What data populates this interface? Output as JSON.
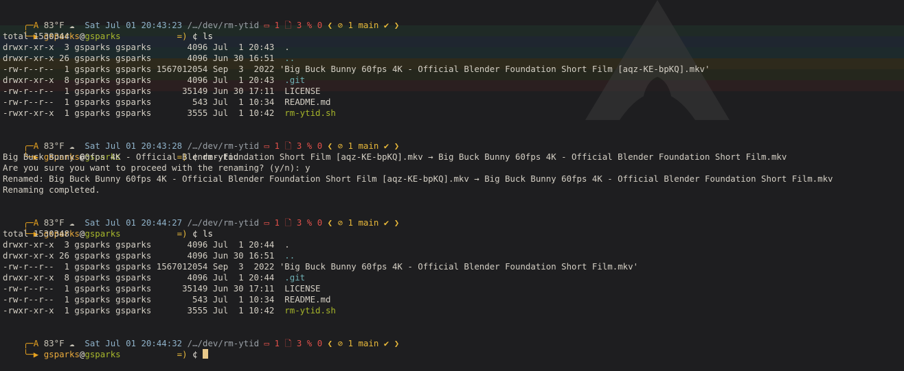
{
  "theme": {
    "accent": "#e6a11f",
    "background": "#1e1e20",
    "user_color": "#e8a93c",
    "host_color": "#a8b82c",
    "git_status_red": "#e0504a",
    "git_branch_yellow": "#e8b83a",
    "script_green": "#a6b52a",
    "dir_teal": "#6fb0b4"
  },
  "icons": {
    "prompt_corner": "╭─",
    "prompt_corner_bottom": "╰─▶",
    "weather": "☁",
    "folder": "▭",
    "file": "🗋",
    "percent": "%",
    "branch": "⊘",
    "diverge": "⫰",
    "check": "✔",
    "chevron_left": "❮",
    "chevron_right": "❯",
    "shell_symbol": "¢"
  },
  "prompts": [
    {
      "top": {
        "arrow": "A",
        "temp": "83°F",
        "datetime": "Sat Jul 01 20:43:23",
        "path": "/…/dev/rm-ytid",
        "folders": "1",
        "files": "3",
        "percent": "0",
        "ahead": "1",
        "branch": "main"
      },
      "bottom": {
        "user": "gsparks",
        "at": "@",
        "host": "gsparks",
        "pad": "           ",
        "eq": "=)",
        "sym": "¢",
        "command": "ls"
      }
    },
    {
      "top": {
        "arrow": "A",
        "temp": "83°F",
        "datetime": "Sat Jul 01 20:43:28",
        "path": "/…/dev/rm-ytid",
        "folders": "1",
        "files": "3",
        "percent": "0",
        "ahead": "1",
        "branch": "main"
      },
      "bottom": {
        "user": "gsparks",
        "at": "@",
        "host": "gsparks",
        "pad": "           ",
        "eq": "=)",
        "sym": "¢",
        "command": "rm-ytid"
      }
    },
    {
      "top": {
        "arrow": "A",
        "temp": "83°F",
        "datetime": "Sat Jul 01 20:44:27",
        "path": "/…/dev/rm-ytid",
        "folders": "1",
        "files": "3",
        "percent": "0",
        "ahead": "1",
        "branch": "main"
      },
      "bottom": {
        "user": "gsparks",
        "at": "@",
        "host": "gsparks",
        "pad": "           ",
        "eq": "=)",
        "sym": "¢",
        "command": "ls"
      }
    },
    {
      "top": {
        "arrow": "A",
        "temp": "83°F",
        "datetime": "Sat Jul 01 20:44:32",
        "path": "/…/dev/rm-ytid",
        "folders": "1",
        "files": "3",
        "percent": "0",
        "ahead": "1",
        "branch": "main"
      },
      "bottom": {
        "user": "gsparks",
        "at": "@",
        "host": "gsparks",
        "pad": "           ",
        "eq": "=)",
        "sym": "¢",
        "command": ""
      }
    }
  ],
  "ls1": {
    "total": "total 1530344",
    "rows": [
      {
        "meta": "drwxr-xr-x  3 gsparks gsparks       4096 Jul  1 20:43  ",
        "name": ".",
        "kind": "plain"
      },
      {
        "meta": "drwxr-xr-x 26 gsparks gsparks       4096 Jun 30 16:51  ",
        "name": "..",
        "kind": "dir"
      },
      {
        "meta": "-rw-r--r--  1 gsparks gsparks 1567012054 Sep  3  2022 ",
        "name": "'Big Buck Bunny 60fps 4K - Official Blender Foundation Short Film [aqz-KE-bpKQ].mkv'",
        "kind": "plain"
      },
      {
        "meta": "drwxr-xr-x  8 gsparks gsparks       4096 Jul  1 20:43  ",
        "name": ".git",
        "kind": "dir"
      },
      {
        "meta": "-rw-r--r--  1 gsparks gsparks      35149 Jun 30 17:11  ",
        "name": "LICENSE",
        "kind": "plain"
      },
      {
        "meta": "-rw-r--r--  1 gsparks gsparks        543 Jul  1 10:34  ",
        "name": "README.md",
        "kind": "plain"
      },
      {
        "meta": "-rwxr-xr-x  1 gsparks gsparks       3555 Jul  1 10:42  ",
        "name": "rm-ytid.sh",
        "kind": "exec"
      }
    ]
  },
  "rename_output": [
    "Big Buck Bunny 60fps 4K - Official Blender Foundation Short Film [aqz-KE-bpKQ].mkv → Big Buck Bunny 60fps 4K - Official Blender Foundation Short Film.mkv",
    "Are you sure you want to proceed with the renaming? (y/n): y",
    "Renamed: Big Buck Bunny 60fps 4K - Official Blender Foundation Short Film [aqz-KE-bpKQ].mkv → Big Buck Bunny 60fps 4K - Official Blender Foundation Short Film.mkv",
    "Renaming completed."
  ],
  "ls2": {
    "total": "total 1530348",
    "rows": [
      {
        "meta": "drwxr-xr-x  3 gsparks gsparks       4096 Jul  1 20:44  ",
        "name": ".",
        "kind": "plain"
      },
      {
        "meta": "drwxr-xr-x 26 gsparks gsparks       4096 Jun 30 16:51  ",
        "name": "..",
        "kind": "dir"
      },
      {
        "meta": "-rw-r--r--  1 gsparks gsparks 1567012054 Sep  3  2022 ",
        "name": "'Big Buck Bunny 60fps 4K - Official Blender Foundation Short Film.mkv'",
        "kind": "plain"
      },
      {
        "meta": "drwxr-xr-x  8 gsparks gsparks       4096 Jul  1 20:44  ",
        "name": ".git",
        "kind": "dir"
      },
      {
        "meta": "-rw-r--r--  1 gsparks gsparks      35149 Jun 30 17:11  ",
        "name": "LICENSE",
        "kind": "plain"
      },
      {
        "meta": "-rw-r--r--  1 gsparks gsparks        543 Jul  1 10:34  ",
        "name": "README.md",
        "kind": "plain"
      },
      {
        "meta": "-rwxr-xr-x  1 gsparks gsparks       3555 Jul  1 10:42  ",
        "name": "rm-ytid.sh",
        "kind": "exec"
      }
    ]
  }
}
